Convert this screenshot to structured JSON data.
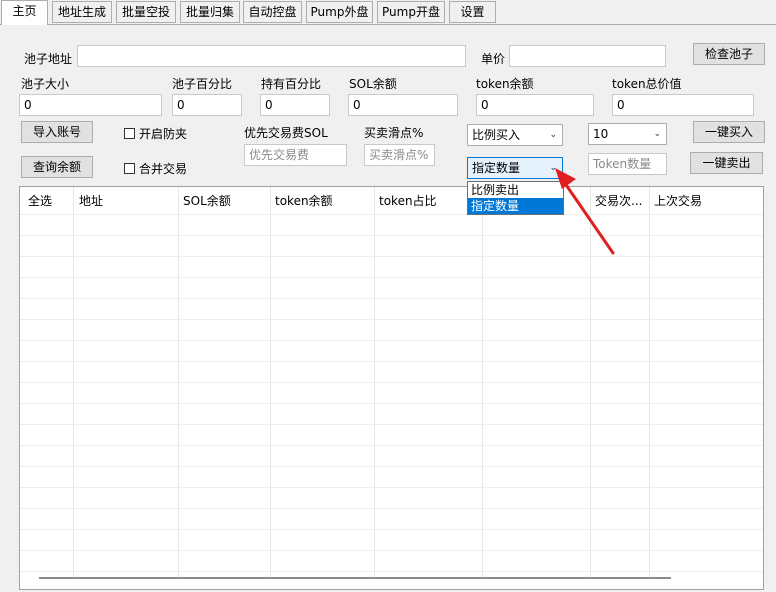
{
  "tabs": [
    "主页",
    "地址生成",
    "批量空投",
    "批量归集",
    "自动控盘",
    "Pump外盘",
    "Pump开盘",
    "设置"
  ],
  "labels": {
    "pool_address": "池子地址",
    "unit_price": "单价",
    "pool_size": "池子大小",
    "pool_percent": "池子百分比",
    "hold_percent": "持有百分比",
    "sol_balance": "SOL余额",
    "token_balance": "token余额",
    "token_total_value": "token总价值",
    "priority_fee_label": "优先交易费SOL",
    "slippage_label": "买卖滑点%"
  },
  "fields": {
    "pool_address": "",
    "unit_price": "",
    "pool_size": "0",
    "pool_percent": "0",
    "hold_percent": "0",
    "sol_balance": "0",
    "token_balance": "0",
    "token_total_value": "0",
    "priority_fee_placeholder": "优先交易费",
    "slippage_placeholder": "买卖滑点%",
    "token_amount_placeholder": "Token数量"
  },
  "buttons": {
    "check_pool": "检查池子",
    "import_accounts": "导入账号",
    "query_balance": "查询余额",
    "one_click_buy": "一键买入",
    "one_click_sell": "一键卖出"
  },
  "checkboxes": {
    "anti_sandwich": "开启防夹",
    "merge_trades": "合并交易"
  },
  "combos": {
    "buy_mode": "比例买入",
    "buy_amount": "10",
    "sell_mode": "指定数量"
  },
  "sell_mode_options": [
    "比例卖出",
    "指定数量"
  ],
  "table_headers": [
    "全选",
    "地址",
    "SOL余额",
    "token余额",
    "token占比",
    "交易次...",
    "上次交易"
  ]
}
